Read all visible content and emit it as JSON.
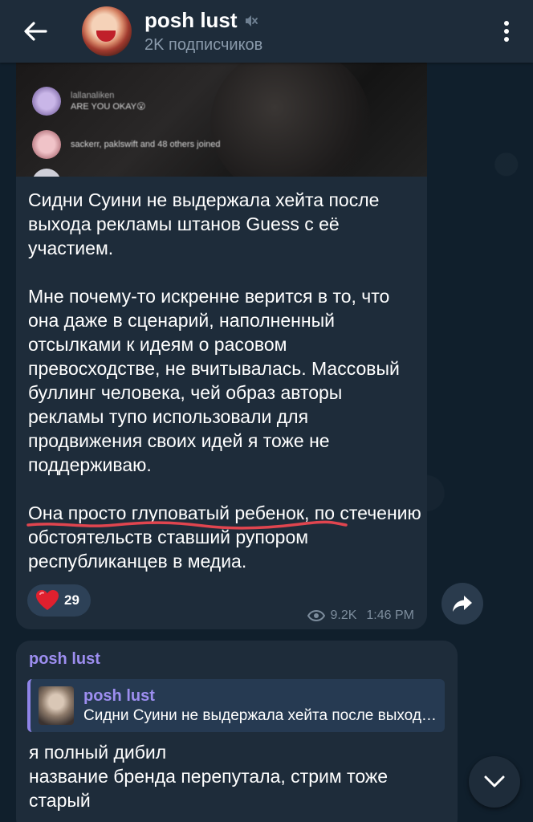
{
  "header": {
    "back_icon": "arrow-left-icon",
    "channel_title": "posh lust",
    "muted_icon": "muted-speaker-icon",
    "subscribers": "2K подписчиков",
    "menu_icon": "more-vertical-icon"
  },
  "post": {
    "media_comments": [
      {
        "user": "lallanaliken",
        "text": "ARE YOU OKAY😮"
      },
      {
        "user": "",
        "text": "sackerr, paklswift and 48 others joined"
      }
    ],
    "paragraphs": [
      "Сидни Суини не выдержала хейта после выхода рекламы штанов Guess с её участием.",
      "Мне почему-то искренне верится в то, что она даже в сценарий, наполненный отсылками к идеям о расовом превосходстве, не вчитывалась. Массовый буллинг человека, чей образ авторы рекламы тупо использовали для продвижения своих идей я тоже не поддерживаю."
    ],
    "last_paragraph_underlined": "Она просто глуповатый ребенок",
    "last_paragraph_rest": ", по стечению обстоятельств ставший рупором республиканцев в медиа.",
    "reaction_emoji": "❤️",
    "reaction_count": "29",
    "views": "9.2K",
    "time": "1:46 PM"
  },
  "reply_post": {
    "author": "posh lust",
    "quoted_author": "posh lust",
    "quoted_text": "Сидни Суини не выдержала хейта после выхода рекламы штанов Guess с её участием.",
    "lines": [
      "я полный дибил",
      "название бренда перепутала, стрим тоже старый"
    ]
  },
  "colors": {
    "header_bg": "#1e2c3a",
    "bubble_bg": "#1e2c3a",
    "accent_name": "#9d8ef0",
    "underline": "#e0454f",
    "meta": "#7c8c9c"
  }
}
